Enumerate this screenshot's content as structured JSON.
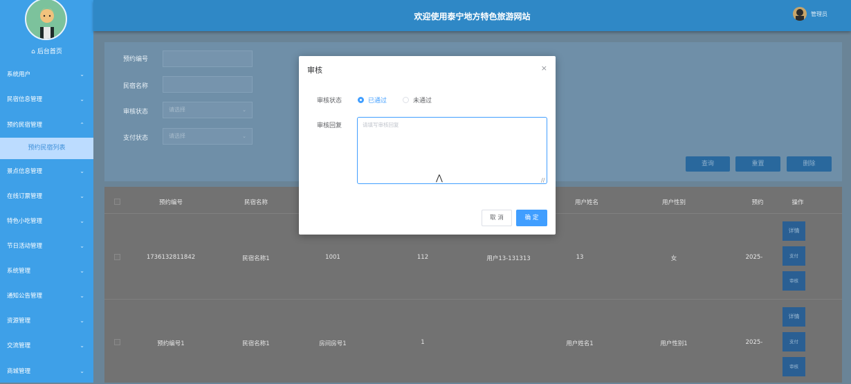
{
  "header": {
    "site_title": "欢迎使用泰宁地方特色旅游网站",
    "admin_name": "管理员"
  },
  "sidebar": {
    "home_label": "后台首页",
    "items": [
      {
        "label": "系统用户"
      },
      {
        "label": "民宿信息管理"
      },
      {
        "label": "预约民宿管理"
      },
      {
        "label": "景点信息管理"
      },
      {
        "label": "在线订票管理"
      },
      {
        "label": "特色小吃管理"
      },
      {
        "label": "节日活动管理"
      },
      {
        "label": "系统管理"
      },
      {
        "label": "通知公告管理"
      },
      {
        "label": "资源管理"
      },
      {
        "label": "交流管理"
      },
      {
        "label": "商城管理"
      }
    ],
    "active_sub": "预约民宿列表"
  },
  "search": {
    "fields": [
      {
        "label": "预约编号"
      },
      {
        "label": "民宿名称"
      },
      {
        "label": "审核状态",
        "placeholder": "请选择"
      },
      {
        "label": "支付状态",
        "placeholder": "请选择"
      }
    ],
    "buttons": [
      "查询",
      "重置",
      "删除"
    ]
  },
  "table": {
    "headers": [
      "预约编号",
      "民宿名称",
      "用户姓名",
      "用户性别",
      "预约",
      "操作"
    ],
    "rows": [
      {
        "cells": [
          "1736132811842",
          "民宿名称1",
          "1001",
          "112",
          "用户13-131313",
          "13",
          "女",
          "2025-"
        ]
      },
      {
        "cells": [
          "预约编号1",
          "民宿名称1",
          "房间房号1",
          "1",
          "用户姓名1",
          "用户性别1",
          "2025-"
        ]
      }
    ],
    "row_buttons": [
      "详情",
      "支付",
      "审核"
    ]
  },
  "dialog": {
    "title": "审核",
    "close": "×",
    "status_label": "审核状态",
    "options": [
      "已通过",
      "未通过"
    ],
    "reply_label": "审核回复",
    "reply_placeholder": "请填写审核回复",
    "cancel": "取 消",
    "confirm": "确 定"
  },
  "colors": {
    "sidebar": "#3ea0e8",
    "topbar": "#2f88c6",
    "accent": "#409eff"
  }
}
